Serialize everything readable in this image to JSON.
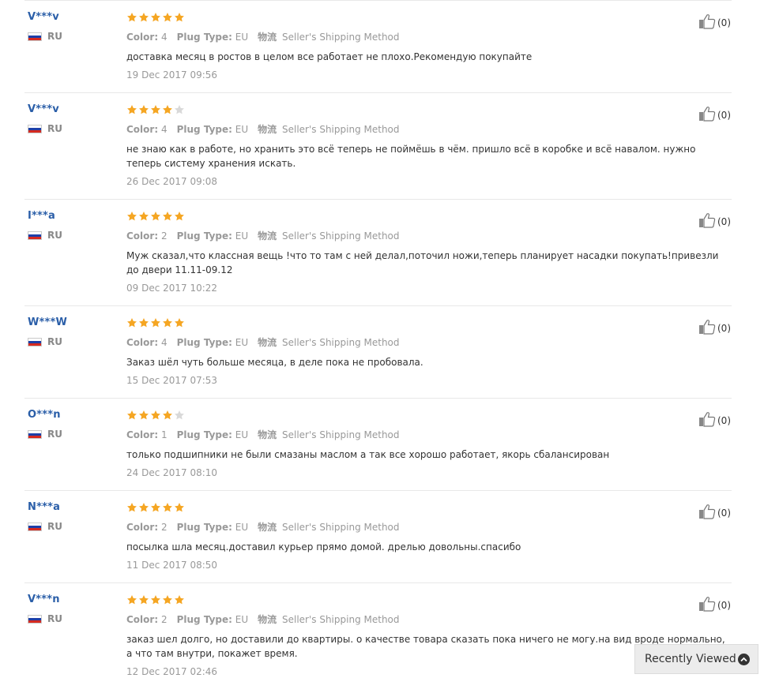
{
  "labels": {
    "color": "Color:",
    "plug_type": "Plug Type:",
    "shipping_icon_text": "物流",
    "shipping": "Seller's Shipping Method"
  },
  "colors": {
    "star_on": "#f5a623",
    "star_off": "#d9d9d9",
    "username": "#2a5ea8"
  },
  "reviews": [
    {
      "user": "V***v",
      "country": "RU",
      "rating": 5,
      "color": "4",
      "plug": "EU",
      "text": "доставка месяц в ростов в целом все работает не плохо.Рекомендую покупайте",
      "date": "19 Dec 2017 09:56",
      "likes": "(0)"
    },
    {
      "user": "V***v",
      "country": "RU",
      "rating": 4,
      "color": "4",
      "plug": "EU",
      "text": "не знаю как в работе, но хранить это всё теперь не поймёшь в чём. пришло всё в коробке и всё навалом. нужно теперь систему хранения искать.",
      "date": "26 Dec 2017 09:08",
      "likes": "(0)"
    },
    {
      "user": "I***a",
      "country": "RU",
      "rating": 5,
      "color": "2",
      "plug": "EU",
      "text": "Муж сказал,что классная вещь !что то там с ней делал,поточил ножи,теперь планирует насадки покупать!привезли до двери 11.11-09.12",
      "date": "09 Dec 2017 10:22",
      "likes": "(0)"
    },
    {
      "user": "W***W",
      "country": "RU",
      "rating": 5,
      "color": "4",
      "plug": "EU",
      "text": "Заказ шёл чуть больше месяца, в деле пока не пробовала.",
      "date": "15 Dec 2017 07:53",
      "likes": "(0)"
    },
    {
      "user": "O***n",
      "country": "RU",
      "rating": 4,
      "color": "1",
      "plug": "EU",
      "text": "только подшипники не были смазаны маслом а так все хорошо работает, якорь сбалансирован",
      "date": "24 Dec 2017 08:10",
      "likes": "(0)"
    },
    {
      "user": "N***a",
      "country": "RU",
      "rating": 5,
      "color": "2",
      "plug": "EU",
      "text": "посылка шла месяц.доставил курьер прямо домой. дрелью довольны.спасибо",
      "date": "11 Dec 2017 08:50",
      "likes": "(0)"
    },
    {
      "user": "V***n",
      "country": "RU",
      "rating": 5,
      "color": "2",
      "plug": "EU",
      "text": "заказ шел долго, но доставили до квартиры. о качестве товара сказать пока ничего не могу.на вид вроде нормально, а что там внутри, покажет время.",
      "date": "12 Dec 2017 02:46",
      "likes": "(0)"
    }
  ],
  "recently_viewed": {
    "label": "Recently Viewed"
  }
}
